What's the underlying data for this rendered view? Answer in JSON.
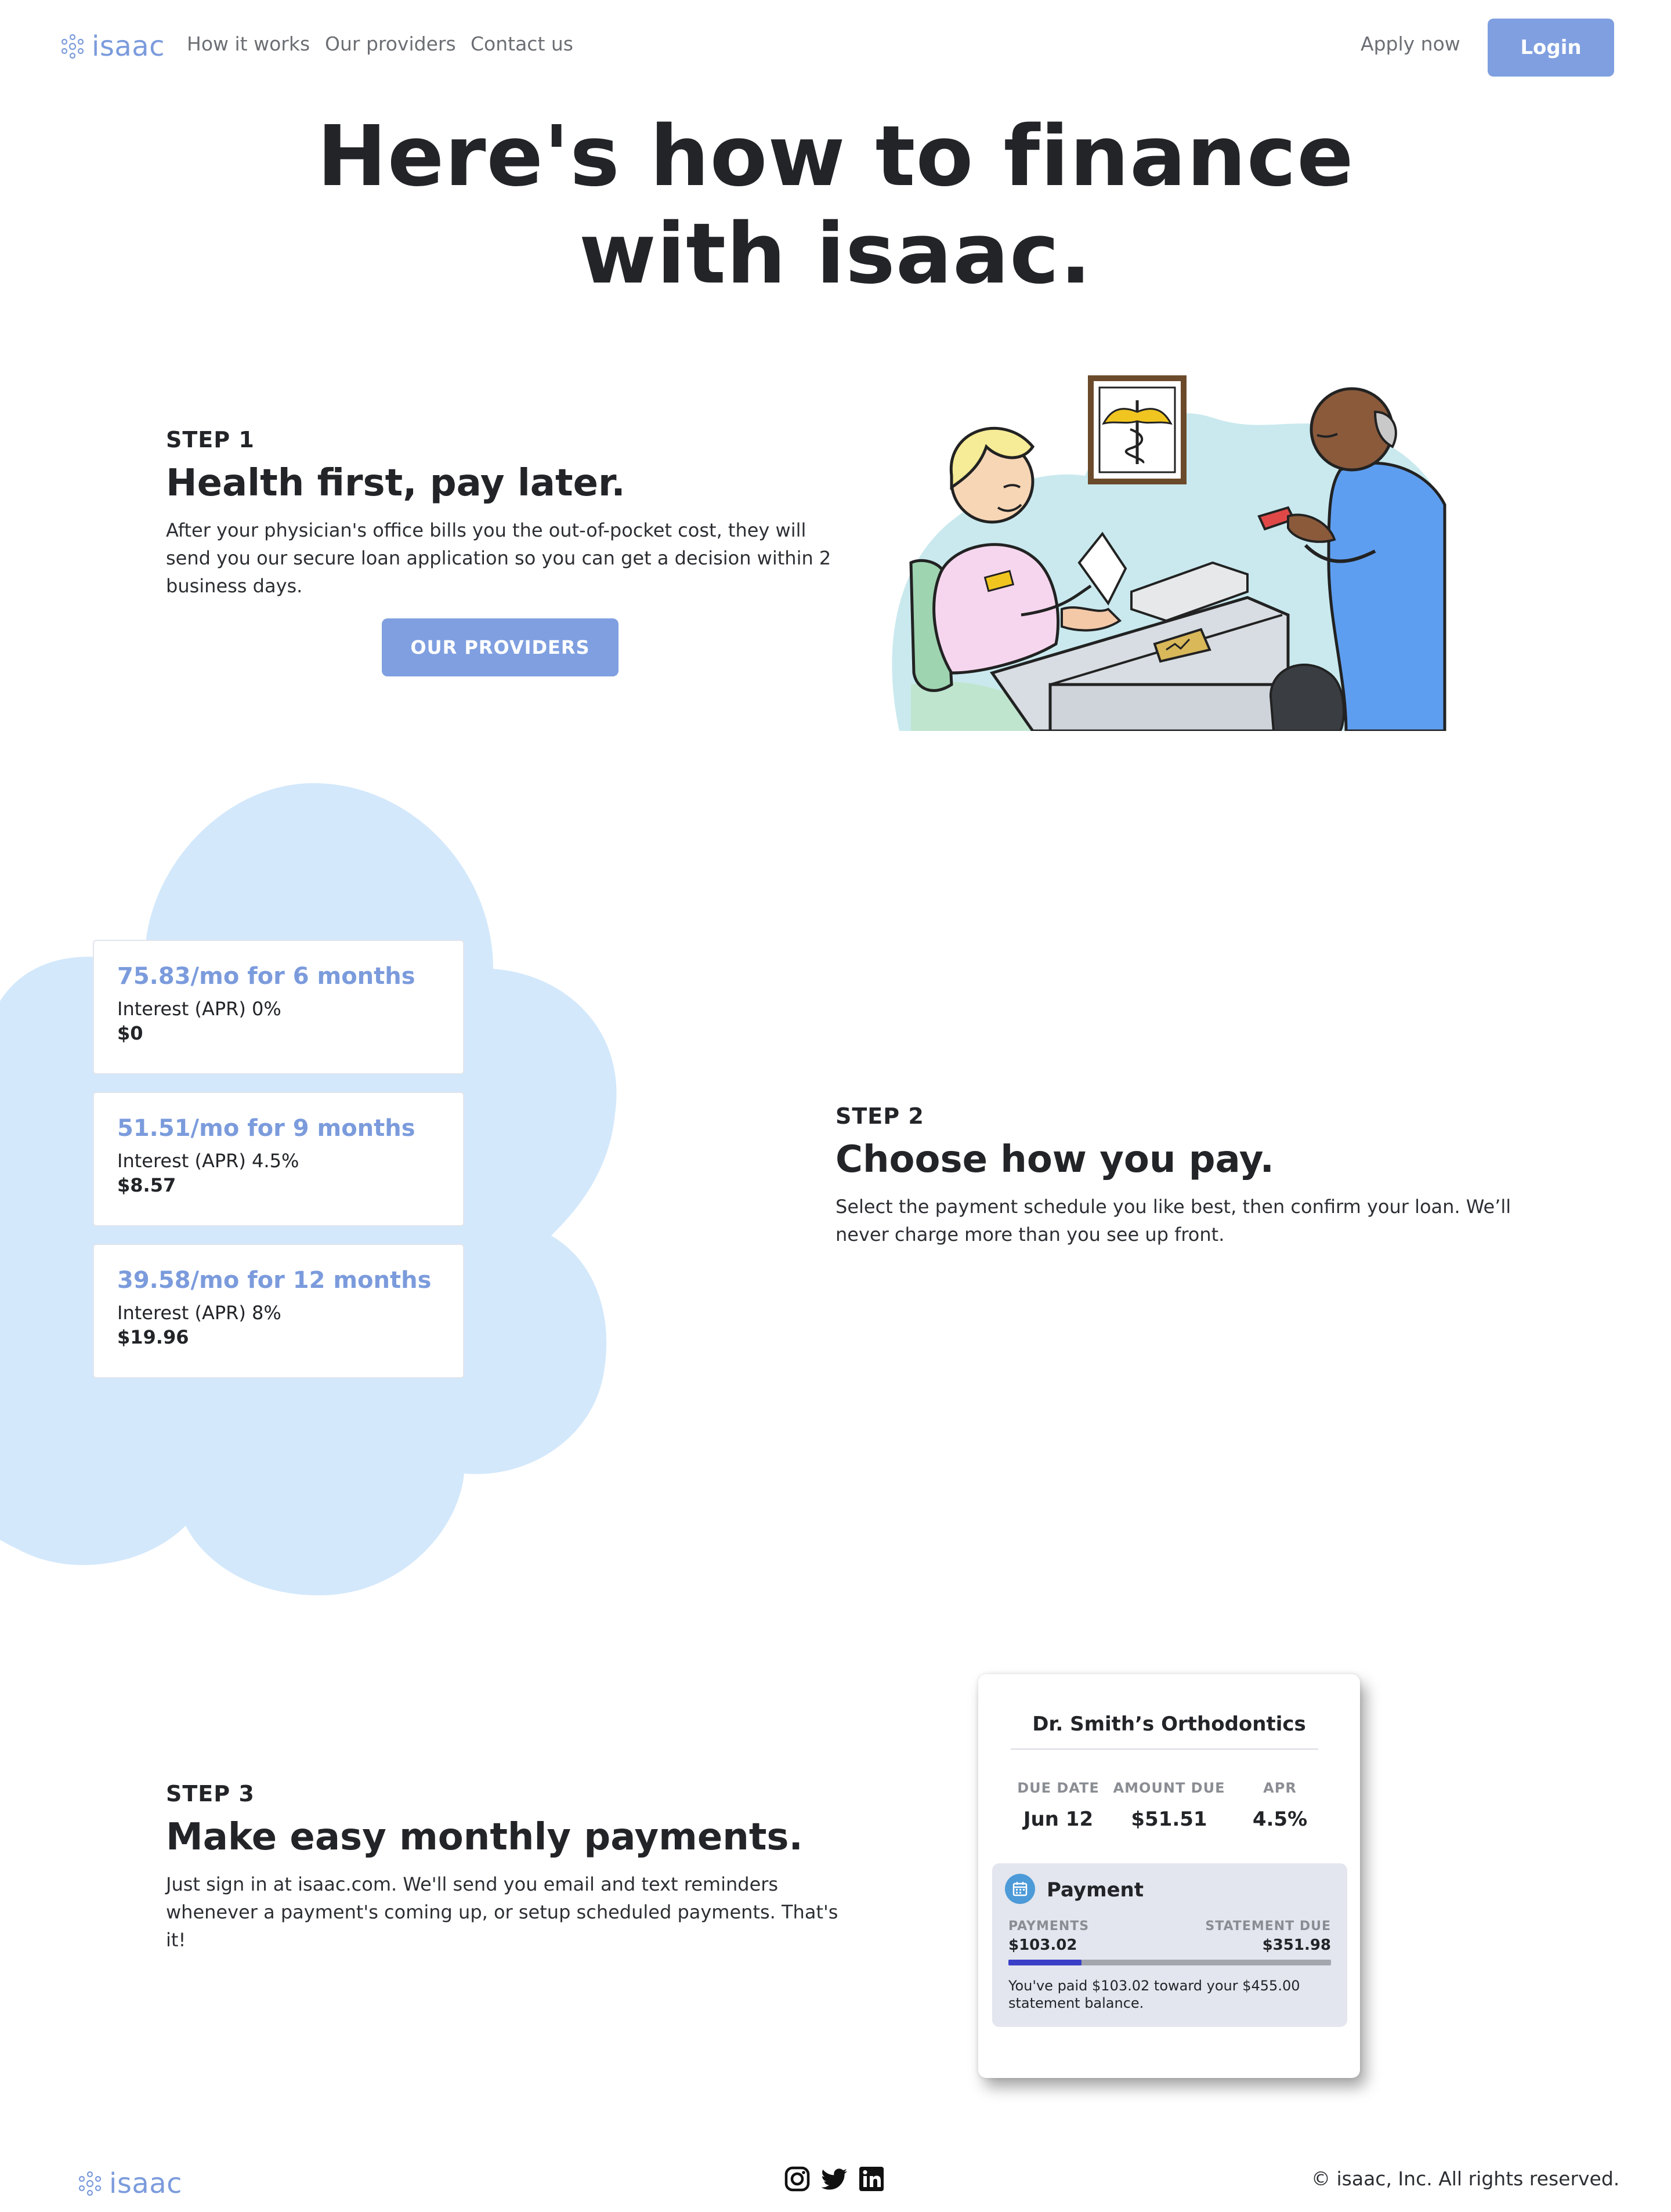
{
  "nav": {
    "logo_text": "isaac",
    "links": [
      "How it works",
      "Our providers",
      "Contact us"
    ],
    "apply_label": "Apply now",
    "login_label": "Login"
  },
  "hero": {
    "line1": "Here's how to finance",
    "line2": "with isaac."
  },
  "step1": {
    "label": "STEP 1",
    "title": "Health first, pay later.",
    "body": "After your physician's office bills you the out-of-pocket cost, they will send you our secure loan application so you can get a decision within 2 business days.",
    "button_label": "OUR PROVIDERS"
  },
  "step2": {
    "label": "STEP 2",
    "title": "Choose how you pay.",
    "body": "Select the payment schedule you like best, then confirm your loan. We’ll never charge more than you see up front.",
    "options": [
      {
        "rate": "75.83/mo for 6 months",
        "apr": "Interest (APR) 0%",
        "cost": "$0"
      },
      {
        "rate": "51.51/mo for 9 months",
        "apr": "Interest (APR) 4.5%",
        "cost": "$8.57"
      },
      {
        "rate": "39.58/mo for 12 months",
        "apr": "Interest (APR) 8%",
        "cost": "$19.96"
      }
    ]
  },
  "step3": {
    "label": "STEP 3",
    "title": "Make easy monthly payments.",
    "body": "Just sign in at isaac.com. We'll send you email and text reminders whenever a payment's coming up, or setup scheduled payments. That's it!",
    "card": {
      "provider": "Dr. Smith’s Orthodontics",
      "columns": [
        {
          "head": "DUE DATE",
          "value": "Jun 12"
        },
        {
          "head": "AMOUNT DUE",
          "value": "$51.51"
        },
        {
          "head": "APR",
          "value": "4.5%"
        }
      ],
      "payment_heading": "Payment",
      "payments_label": "PAYMENTS",
      "payments_value": "$103.02",
      "statement_label": "STATEMENT DUE",
      "statement_value": "$351.98",
      "progress_fraction": 0.2264,
      "note": "You've paid $103.02 toward your $455.00 statement balance."
    }
  },
  "footer": {
    "logo_text": "isaac",
    "social_icons": [
      "instagram-icon",
      "twitter-icon",
      "linkedin-icon"
    ],
    "copyright": "© isaac, Inc. All rights reserved."
  },
  "colors": {
    "brand": "#7b9bdc",
    "button": "#7f9fe0",
    "cloud": "#d3e8fb",
    "progress": "#3b3fc8"
  }
}
